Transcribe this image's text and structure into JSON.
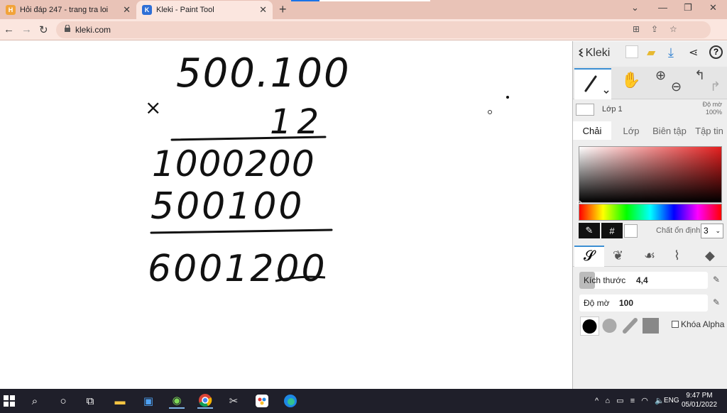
{
  "browser": {
    "tabs": [
      {
        "title": "Hỏi đáp 247 - trang tra loi",
        "active": false
      },
      {
        "title": "Kleki - Paint Tool",
        "active": true
      }
    ],
    "url": "kleki.com"
  },
  "canvas": {
    "handwriting": {
      "line1": "500.100",
      "times": "×",
      "line2": "12",
      "partial1": "1000200",
      "partial2": "500100",
      "result": "6001200"
    }
  },
  "panel": {
    "brand": "Kleki",
    "layer_name": "Lớp 1",
    "opacity_label": "Độ mờ",
    "opacity_value": "100%",
    "tabs": [
      "Chải",
      "Lớp",
      "Biên tập",
      "Tập tin"
    ],
    "stabilizer_label": "Chất ổn định",
    "stabilizer_value": "3",
    "hex_symbol": "#",
    "size_slider": {
      "label": "Kích thước",
      "value": "4,4",
      "fill": 0.12
    },
    "opacity_slider": {
      "label": "Độ mờ",
      "value": "100"
    },
    "lock_alpha": "Khóa Alpha",
    "colors": {
      "accent": "#3b8fd3",
      "current_color": "#000000",
      "secondary_color": "#ffffff"
    }
  },
  "taskbar": {
    "language": "ENG",
    "time": "9:47 PM",
    "date": "05/01/2022"
  }
}
